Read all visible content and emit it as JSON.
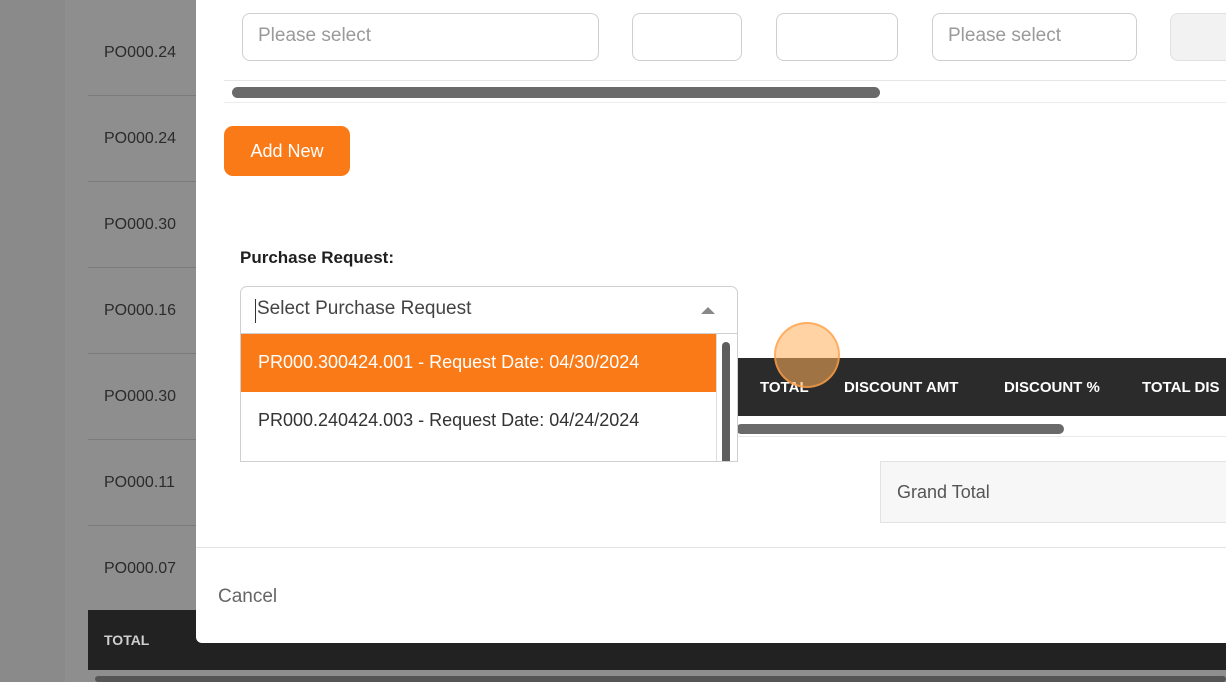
{
  "background": {
    "rows": [
      "PO000.24",
      "PO000.24",
      "PO000.30",
      "PO000.16",
      "PO000.30",
      "PO000.11",
      "PO000.07"
    ],
    "total_label": "TOTAL"
  },
  "modal": {
    "top_inputs": {
      "select_1_placeholder": "Please select",
      "select_2_placeholder": "Please select"
    },
    "add_new_label": "Add New",
    "purchase_request": {
      "label": "Purchase Request:",
      "placeholder": "Select Purchase Request",
      "options": [
        "PR000.300424.001 - Request Date: 04/30/2024",
        "PR000.240424.003 - Request Date: 04/24/2024"
      ]
    },
    "table_headers": [
      "TOTAL",
      "DISCOUNT AMT",
      "DISCOUNT %",
      "TOTAL DIS"
    ],
    "grand_total_label": "Grand Total",
    "cancel_label": "Cancel"
  },
  "colors": {
    "accent": "#f97a17",
    "header_dark": "#2b2b2b"
  }
}
